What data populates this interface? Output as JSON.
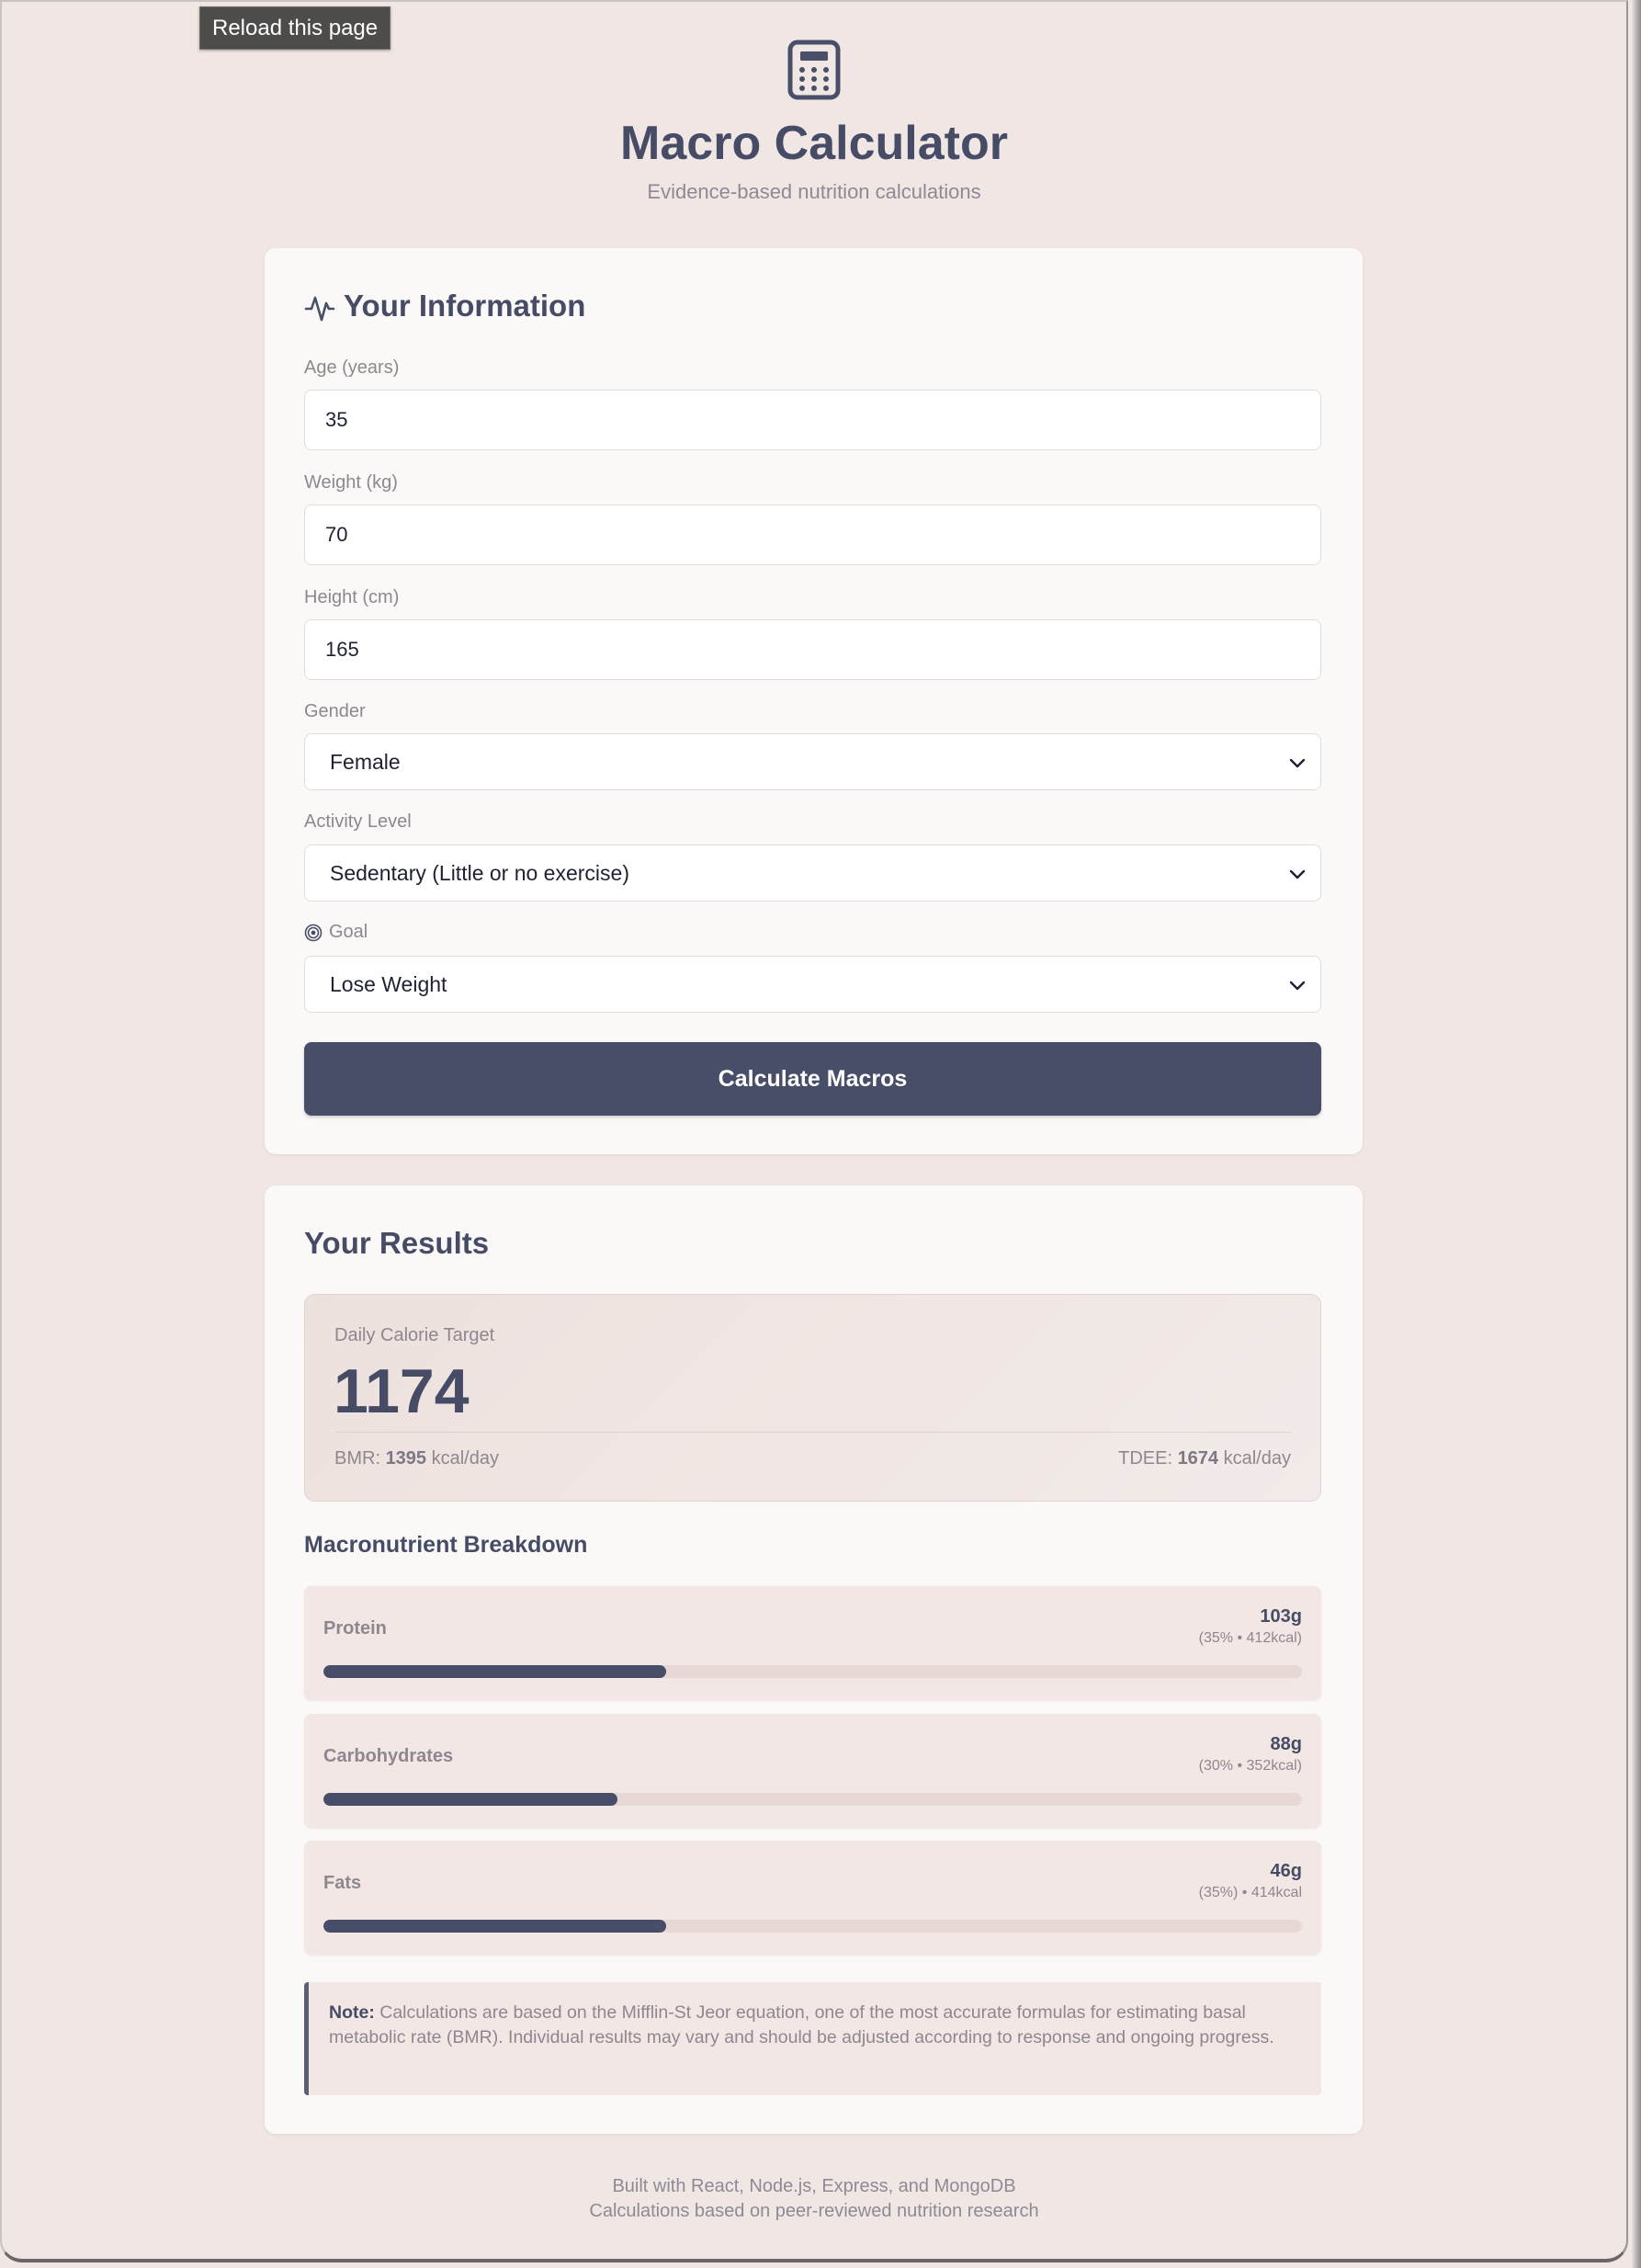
{
  "browser": {
    "tooltip": "Reload this page"
  },
  "header": {
    "icon": "calculator-icon",
    "title": "Macro Calculator",
    "subtitle": "Evidence-based nutrition calculations"
  },
  "form": {
    "title": "Your Information",
    "title_icon": "activity-pulse-icon",
    "age": {
      "label": "Age (years)",
      "value": "35"
    },
    "weight": {
      "label": "Weight (kg)",
      "value": "70"
    },
    "height": {
      "label": "Height (cm)",
      "value": "165"
    },
    "gender": {
      "label": "Gender",
      "value": "Female"
    },
    "activity": {
      "label": "Activity Level",
      "value": "Sedentary (Little or no exercise)"
    },
    "goal": {
      "label": "Goal",
      "value": "Lose Weight",
      "icon": "target-icon"
    },
    "submit_label": "Calculate Macros"
  },
  "results": {
    "title": "Your Results",
    "calorie_label": "Daily Calorie Target",
    "calorie_value": "1174",
    "bmr_prefix": "BMR: ",
    "bmr_value": "1395",
    "bmr_unit": " kcal/day",
    "tdee_prefix": "TDEE: ",
    "tdee_value": "1674",
    "tdee_unit": " kcal/day",
    "breakdown_title": "Macronutrient Breakdown",
    "macros": [
      {
        "name": "Protein",
        "grams": "103g",
        "detail": "(35% • 412kcal)",
        "percent": 35
      },
      {
        "name": "Carbohydrates",
        "grams": "88g",
        "detail": "(30% • 352kcal)",
        "percent": 30
      },
      {
        "name": "Fats",
        "grams": "46g",
        "detail": "(35%) • 414kcal",
        "percent": 35
      }
    ],
    "note_label": "Note:",
    "note_text": " Calculations are based on the Mifflin-St Jeor equation, one of the most accurate formulas for estimating basal metabolic rate (BMR). Individual results may vary and should be adjusted according to response and ongoing progress."
  },
  "footer": {
    "line1": "Built with React, Node.js, Express, and MongoDB",
    "line2": "Calculations based on peer-reviewed nutrition research"
  },
  "colors": {
    "background": "#f0e7e4",
    "card": "#fbf9f8",
    "primary": "#484e68",
    "muted_text": "#8e8790",
    "bar_track": "#e8d8d5"
  }
}
